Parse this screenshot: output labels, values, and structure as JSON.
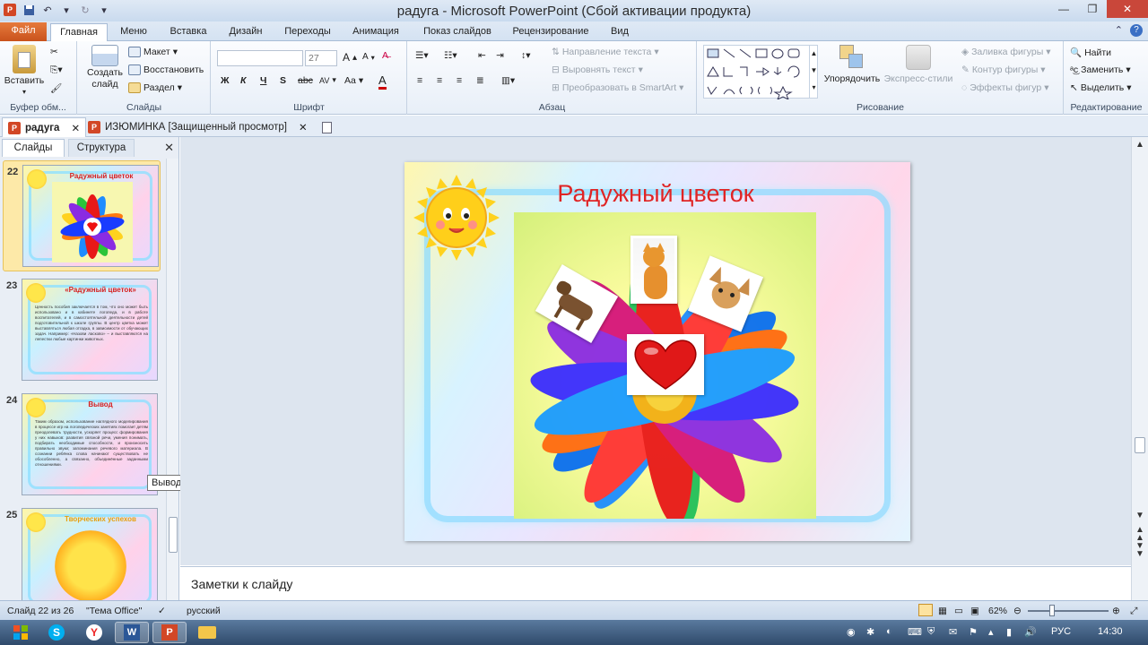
{
  "window": {
    "title": "радуга  -  Microsoft PowerPoint (Сбой активации продукта)"
  },
  "ribbon_tabs": [
    "Файл",
    "Главная",
    "Меню",
    "Вставка",
    "Дизайн",
    "Переходы",
    "Анимация",
    "Показ слайдов",
    "Рецензирование",
    "Вид"
  ],
  "ribbon": {
    "clipboard": {
      "paste": "Вставить",
      "label": "Буфер обм..."
    },
    "slides": {
      "new_slide_line1": "Создать",
      "new_slide_line2": "слайд",
      "layout": "Макет",
      "reset": "Восстановить",
      "section": "Раздел",
      "label": "Слайды"
    },
    "font": {
      "name_value": "",
      "size_value": "27",
      "bold": "Ж",
      "italic": "К",
      "underline": "Ч",
      "strike": "S",
      "shadow": "abc",
      "spacing": "AV",
      "case": "Aa",
      "color": "A",
      "grow": "A",
      "shrink": "A",
      "label": "Шрифт"
    },
    "paragraph": {
      "text_direction": "Направление текста",
      "align_text": "Выровнять текст",
      "smartart": "Преобразовать в SmartArt",
      "label": "Абзац"
    },
    "drawing": {
      "arrange": "Упорядочить",
      "quick_styles": "Экспресс-стили",
      "fill": "Заливка фигуры",
      "outline": "Контур фигуры",
      "effects": "Эффекты фигур",
      "label": "Рисование"
    },
    "editing": {
      "find": "Найти",
      "replace": "Заменить",
      "select": "Выделить",
      "label": "Редактирование"
    }
  },
  "doc_tabs": [
    {
      "label": "радуга",
      "active": true
    },
    {
      "label": "ИЗЮМИНКА [Защищенный просмотр]",
      "active": false
    }
  ],
  "left_panel": {
    "tabs": [
      "Слайды",
      "Структура"
    ],
    "thumbnails": [
      {
        "number": "22",
        "title": "Радужный цветок",
        "text": ""
      },
      {
        "number": "23",
        "title": "«Радужный цветок»",
        "text": "Ценность пособия заключается в том, что оно может быть использовано и в кабинете логопеда, и в работе воспитателей, и в самостоятельной деятельности детей подготовительной к школе группы. В центр цветка может выставляться любая отгадка, в зависимости от обучающих задач. Например: «Назови ласково» – и выставляются на лепестки любые картинки животных."
      },
      {
        "number": "24",
        "title": "Вывод",
        "text": "Таким образом, использование наглядного моделирования в процессе игр на логопедических занятиях помогает детям преодолевать трудности, ускоряет процесс формирования у них навыков: развития связной речи, умения понимать, подбирать необходимые способности, и произносить правильно звуки; запоминания речевого материала. В сознании ребёнка слова начинают существовать не обособленно, а связанно, объединённые заданными отношениями."
      },
      {
        "number": "25",
        "title": "Творческих успехов",
        "text": ""
      }
    ],
    "tooltip": "Вывод"
  },
  "slide": {
    "title": "Радужный цветок"
  },
  "notes": {
    "placeholder": "Заметки к слайду"
  },
  "status": {
    "slide_info": "Слайд 22 из 26",
    "theme": "\"Тема Office\"",
    "language": "русский",
    "zoom": "62%"
  },
  "taskbar": {
    "lang": "РУС",
    "time": "14:30"
  },
  "colors": {
    "accent": "#d24726",
    "ribbon": "#dfe9f5",
    "slide_title": "#e02424"
  }
}
